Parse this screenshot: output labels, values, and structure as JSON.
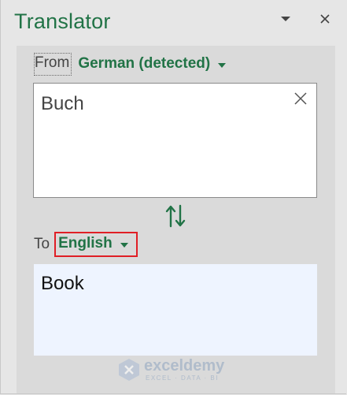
{
  "pane": {
    "title": "Translator",
    "menu_icon": "caret-down-icon",
    "close_icon": "close-icon"
  },
  "source": {
    "from_label": "From",
    "language": "German (detected)",
    "text": "Buch",
    "clear_icon": "close-icon"
  },
  "swap_icon": "swap-arrows-icon",
  "target": {
    "to_label": "To",
    "language": "English",
    "text": "Book"
  },
  "watermark": {
    "name": "exceldemy",
    "tagline": "EXCEL · DATA · BI"
  },
  "colors": {
    "accent": "#217346",
    "highlight": "#e01f26",
    "target_bg": "#eef4ff"
  }
}
